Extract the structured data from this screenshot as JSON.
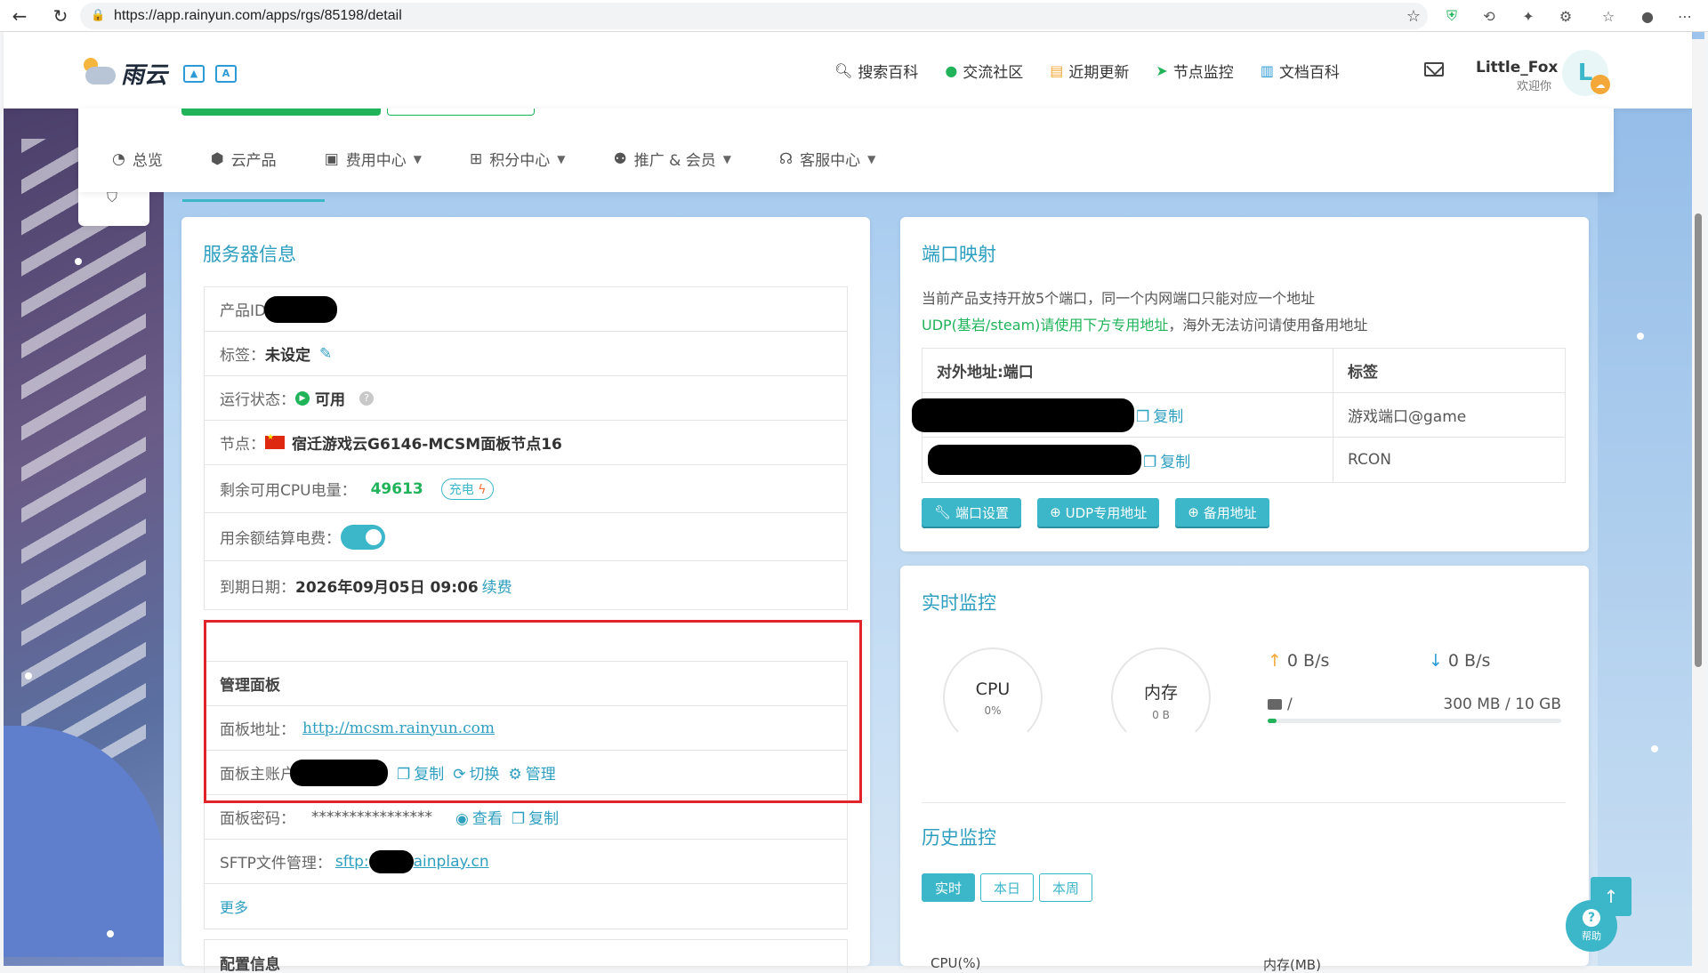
{
  "browser": {
    "url": "https://app.rainyun.com/apps/rgs/85198/detail"
  },
  "header": {
    "brand": "雨云",
    "nav": [
      {
        "label": "搜索百科",
        "icon": "search-icon"
      },
      {
        "label": "交流社区",
        "icon": "wechat-icon"
      },
      {
        "label": "近期更新",
        "icon": "news-icon"
      },
      {
        "label": "节点监控",
        "icon": "location-arrow-icon"
      },
      {
        "label": "文档百科",
        "icon": "book-icon"
      }
    ],
    "username": "Little_Fox",
    "welcome": "欢迎你",
    "avatar_letter": "L"
  },
  "menu": [
    {
      "label": "总览",
      "icon": "dashboard-icon",
      "dropdown": false
    },
    {
      "label": "云产品",
      "icon": "cubes-icon",
      "dropdown": false
    },
    {
      "label": "费用中心",
      "icon": "money-icon",
      "dropdown": true
    },
    {
      "label": "积分中心",
      "icon": "gift-icon",
      "dropdown": true
    },
    {
      "label": "推广 & 会员",
      "icon": "users-icon",
      "dropdown": true
    },
    {
      "label": "客服中心",
      "icon": "headset-icon",
      "dropdown": true
    }
  ],
  "server_info": {
    "title": "服务器信息",
    "product_id_label": "产品ID",
    "tag_label": "标签：",
    "tag_value": "未设定",
    "status_label": "运行状态：",
    "status_value": "可用",
    "node_label": "节点：",
    "node_value": "宿迁游戏云G6146-MCSM面板节点16",
    "cpu_power_label": "剩余可用CPU电量：",
    "cpu_power_value": "49613",
    "charge_label": "充电",
    "balance_billing_label": "用余额结算电费：",
    "expire_label": "到期日期：",
    "expire_value": "2026年09月05日 09:06",
    "renew_label": "续费"
  },
  "management": {
    "title": "管理面板",
    "panel_url_label": "面板地址：",
    "panel_url": "http://mcsm.rainyun.com",
    "account_label": "面板主账户",
    "copy_label": "复制",
    "switch_label": "切换",
    "manage_label": "管理",
    "password_label": "面板密码：",
    "password_mask": "****************",
    "view_label": "查看",
    "sftp_label": "SFTP文件管理：",
    "sftp_prefix": "sftp:",
    "sftp_suffix": "ainplay.cn",
    "more_label": "更多"
  },
  "config": {
    "title": "配置信息"
  },
  "port_mapping": {
    "title": "端口映射",
    "desc1": "当前产品支持开放5个端口，同一个内网端口只能对应一个地址",
    "desc2_green": "UDP(基岩/steam)请使用下方专用地址",
    "desc2_rest": "，海外无法访问请使用备用地址",
    "col_address": "对外地址:端口",
    "col_tag": "标签",
    "rows": [
      {
        "copy": "复制",
        "tag": "游戏端口@game"
      },
      {
        "copy": "复制",
        "tag": "RCON"
      }
    ],
    "buttons": [
      "端口设置",
      "UDP专用地址",
      "备用地址"
    ]
  },
  "realtime": {
    "title": "实时监控",
    "cpu_label": "CPU",
    "cpu_value": "0%",
    "mem_label": "内存",
    "mem_value": "0 B",
    "up_speed": "0 B/s",
    "down_speed": "0 B/s",
    "disk_path": "/",
    "disk_usage": "300 MB / 10 GB",
    "disk_fraction": 0.03
  },
  "history": {
    "title": "历史监控",
    "tabs": [
      "实时",
      "本日",
      "本周"
    ],
    "active_tab": 0,
    "col_cpu": "CPU(%)",
    "col_mem": "内存(MB)"
  },
  "help_label": "帮助",
  "colors": {
    "accent": "#3cb6c9",
    "green": "#20b35a",
    "highlight": "#e0242a"
  }
}
